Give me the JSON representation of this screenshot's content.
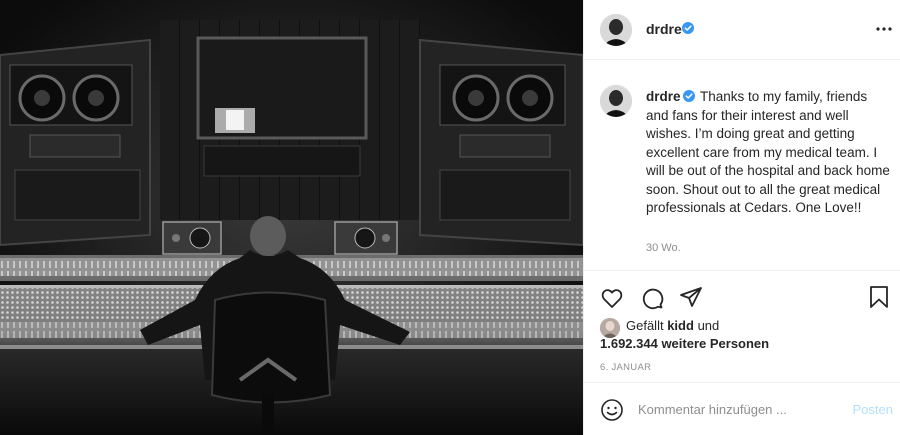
{
  "post": {
    "username": "drdre",
    "verified": true,
    "caption_username": "drdre",
    "caption": "Thanks to my family, friends and fans for their interest and well wishes. I’m doing great and getting excellent care from my medical team. I will be out of the hospital and back home soon. Shout out to all the great medical professionals at Cedars. One Love!!",
    "age": "30 Wo.",
    "image_alt": "Black and white photo of a man seated at a large mixing console in a recording studio"
  },
  "likes": {
    "prefix": "Gefällt",
    "first_liker": "kidd",
    "connector": "und",
    "others": "1.692.344 weitere Personen"
  },
  "date": "6. JANUAR",
  "comment": {
    "placeholder": "Kommentar hinzufügen ...",
    "post_label": "Posten"
  },
  "icons": {
    "more": "more-icon",
    "verified": "verified-badge-icon",
    "like": "heart-icon",
    "comment": "comment-icon",
    "share": "share-icon",
    "save": "bookmark-icon",
    "emoji": "emoji-icon"
  },
  "colors": {
    "verified": "#3897f0",
    "post_button": "#b2dffc",
    "secondary_text": "#8e8e8e",
    "divider": "#efefef"
  }
}
